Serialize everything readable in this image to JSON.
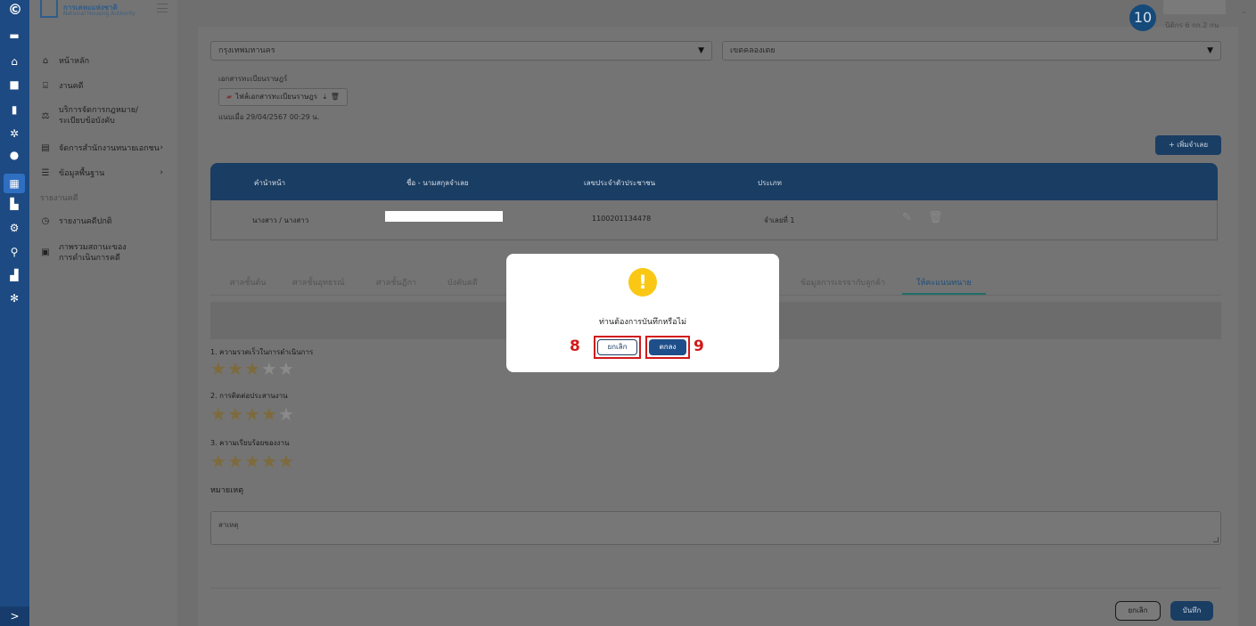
{
  "rail": {
    "icons": [
      "logo-c-icon",
      "briefcase-icon",
      "home-icon",
      "cards-icon",
      "file-icon",
      "settings-icon",
      "user-icon",
      "grid-icon",
      "building-icon",
      "gear-icon",
      "search-icon",
      "chart-icon",
      "cogs-icon"
    ],
    "expand": ">"
  },
  "brand": {
    "title": "การเคหะแห่งชาติ",
    "subtitle": "National Housing Authority"
  },
  "sidebar": {
    "items": [
      {
        "label": "หน้าหลัก",
        "icon": "home-outline-icon"
      },
      {
        "label": "งานคดี",
        "icon": "bank-icon"
      },
      {
        "label": "บริการจัดการกฎหมาย/ระเบียบข้อบังคับ",
        "icon": "scales-icon"
      },
      {
        "label": "จัดการสำนักงานทนายเอกชน",
        "icon": "clipboard-icon"
      },
      {
        "label": "ข้อมูลพื้นฐาน",
        "icon": "list-icon"
      }
    ],
    "section": "รายงานคดี",
    "report_items": [
      {
        "label": "รายงานคดีปกติ",
        "icon": "clock-icon"
      },
      {
        "label": "ภาพรวมสถานะของการดำเนินการคดี",
        "icon": "doc-icon"
      }
    ]
  },
  "user": {
    "badge": "10",
    "name": "นิติกร 6 กก.2 กน"
  },
  "form": {
    "province": "กรุงเทพมหานคร",
    "district": "เขตคลองเตย",
    "doc_label": "เอกสารทะเบียนราษฎร์",
    "file_name": "ไฟล์เอกสารทะเบียนราษฎร",
    "uploaded": "แนบเมื่อ 29/04/2567 00:29 น.",
    "add_label": "+ เพิ่มจำเลย"
  },
  "table": {
    "headers": [
      "คำนำหน้า",
      "ชื่อ - นามสกุลจำเลย",
      "เลขประจำตัวประชาชน",
      "ประเภท"
    ],
    "rows": [
      {
        "prefix": "นางสาว / นางสาว",
        "id": "1100201134478",
        "type": "จำเลยที่ 1"
      }
    ]
  },
  "tabs": [
    "ศาลชั้นต้น",
    "ศาลชั้นอุทธรณ์",
    "ศาลชั้นฎีกา",
    "บังคับคดี",
    "ข้อมูลการเจรจากับลูกค้า",
    "ให้คะแนนทนาย"
  ],
  "rating": {
    "questions": [
      {
        "label": "1. ความรวดเร็วในการดำเนินการ",
        "stars": 3
      },
      {
        "label": "2. การติดต่อประสานงาน",
        "stars": 4
      },
      {
        "label": "3. ความเรียบร้อยของงาน",
        "stars": 5
      }
    ],
    "max_stars": 5
  },
  "note": {
    "label": "หมายเหตุ",
    "placeholder": "สาเหตุ"
  },
  "footer": {
    "cancel": "ยกเลิก",
    "save": "บันทึก"
  },
  "modal": {
    "message": "ท่านต้องการบันทึกหรือไม่",
    "cancel": "ยกเลิก",
    "ok": "ตกลง",
    "step_cancel": "8",
    "step_ok": "9"
  },
  "colors": {
    "rail": "#1d4a82",
    "brand": "#1a3d63",
    "warning": "#fac814",
    "highlight": "#d11a1a"
  }
}
